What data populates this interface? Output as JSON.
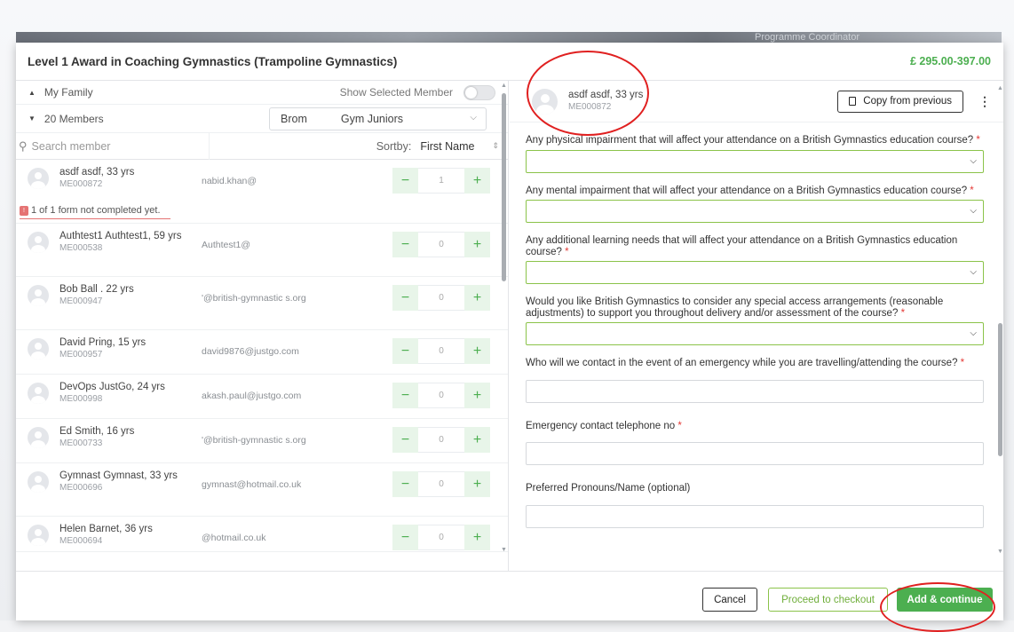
{
  "backdrop": {
    "ghost_text": "Programme Coordinator"
  },
  "modal": {
    "title": "Level 1 Award in Coaching Gymnastics (Trampoline Gymnastics)",
    "price": "£ 295.00-397.00"
  },
  "left": {
    "family_label": "My Family",
    "show_selected_label": "Show Selected Member",
    "members_label": "20 Members",
    "club_select": {
      "part1": "Brom",
      "part2": "Gym Juniors"
    },
    "search_placeholder": "Search member",
    "sort_label": "Sortby:",
    "sort_value": "First Name",
    "form_warning": "1 of 1 form not completed yet.",
    "members": [
      {
        "name": "asdf asdf, 33 yrs",
        "id": "ME000872",
        "email": "nabid.khan@",
        "qty": "1"
      },
      {
        "name": "Authtest1 Authtest1, 59 yrs",
        "id": "ME000538",
        "email": "Authtest1@",
        "qty": "0"
      },
      {
        "name": "Bob Ball .          22 yrs",
        "id": "ME000947",
        "email": "'@british-gymnastic s.org",
        "qty": "0"
      },
      {
        "name": "David Pring, 15 yrs",
        "id": "ME000957",
        "email": "david9876@justgo.com",
        "qty": "0"
      },
      {
        "name": "DevOps JustGo, 24 yrs",
        "id": "ME000998",
        "email": "akash.paul@justgo.com",
        "qty": "0"
      },
      {
        "name": "Ed Smith, 16 yrs",
        "id": "ME000733",
        "email": "'@british-gymnastic s.org",
        "qty": "0"
      },
      {
        "name": "Gymnast Gymnast, 33 yrs",
        "id": "ME000696",
        "email": "gymnast@hotmail.co.uk",
        "qty": "0"
      },
      {
        "name": "Helen Barnet, 36 yrs",
        "id": "ME000694",
        "email": "@hotmail.co.uk",
        "qty": "0"
      }
    ]
  },
  "right": {
    "member_name": "asdf asdf, 33 yrs",
    "member_id": "ME000872",
    "copy_button": "Copy from previous",
    "questions": [
      "Any physical impairment that will affect your attendance on a British Gymnastics education course?",
      "Any mental impairment that will affect your attendance on a British Gymnastics education course?",
      "Any additional learning needs that will affect your attendance on a British Gymnastics education course?",
      "Would you like British Gymnastics to consider any special access arrangements (reasonable adjustments) to support you throughout delivery and/or assessment of the course?",
      "Who will we contact in the event of an emergency while you are travelling/attending the course?",
      "Emergency contact telephone no",
      "Preferred Pronouns/Name (optional)"
    ],
    "required_mark": "*"
  },
  "footer": {
    "cancel": "Cancel",
    "checkout": "Proceed to checkout",
    "add": "Add & continue"
  },
  "colors": {
    "accent": "#4caf50",
    "annotation": "#e02020",
    "required": "#e53935"
  }
}
